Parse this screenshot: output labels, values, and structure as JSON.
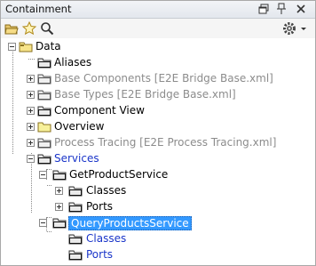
{
  "panel": {
    "title": "Containment"
  },
  "titlebar_buttons": [
    "restore-icon",
    "pin-icon",
    "close-icon"
  ],
  "toolbar": {
    "tools": [
      "open-folder-icon",
      "favorite-star-icon",
      "search-icon",
      "gear-icon",
      "dropdown-arrow-icon"
    ]
  },
  "tree": {
    "root": "Data",
    "items": [
      {
        "label": "Aliases"
      },
      {
        "label": "Base Components [E2E Bridge Base.xml]"
      },
      {
        "label": "Base Types [E2E Bridge Base.xml]"
      },
      {
        "label": "Component View"
      },
      {
        "label": "Overview"
      },
      {
        "label": "Process Tracing [E2E Process Tracing.xml]"
      },
      {
        "label": "Services"
      },
      {
        "label": "GetProductService"
      },
      {
        "label": "Classes"
      },
      {
        "label": "Ports"
      },
      {
        "label": "QueryProductsService"
      },
      {
        "label": "Classes"
      },
      {
        "label": "Ports"
      }
    ]
  },
  "colors": {
    "selection": "#3399ff",
    "link_text": "#1a35c9",
    "disabled_text": "#8c8c8c"
  }
}
